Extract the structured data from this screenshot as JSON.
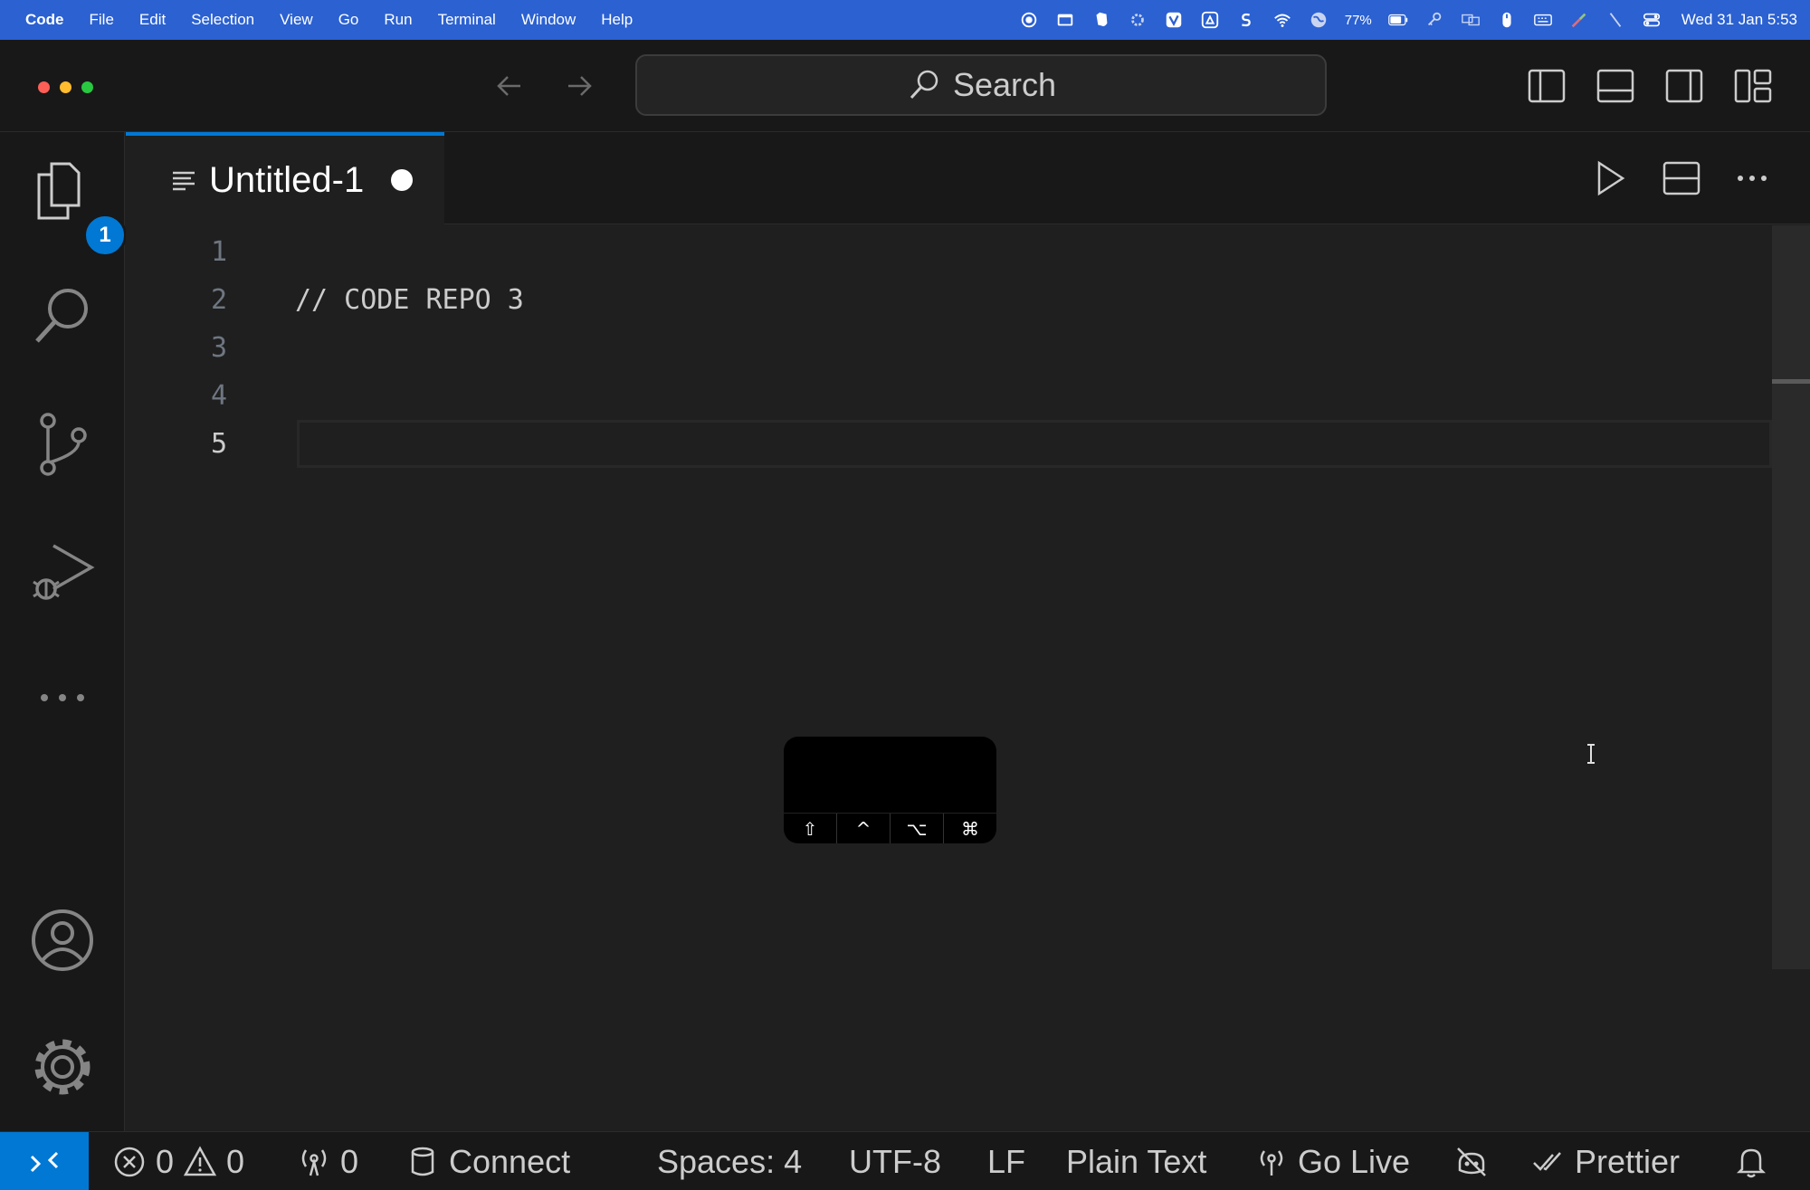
{
  "menubar": {
    "apple": "",
    "items": [
      "Code",
      "File",
      "Edit",
      "Selection",
      "View",
      "Go",
      "Run",
      "Terminal",
      "Window",
      "Help"
    ],
    "battery": "77%",
    "clock": "Wed 31 Jan 5:53"
  },
  "titlebar": {
    "search_label": "Search"
  },
  "activity": {
    "explorer_badge": "1"
  },
  "tab": {
    "label": "Untitled-1"
  },
  "editor": {
    "line_numbers": [
      "1",
      "2",
      "3",
      "4",
      "5"
    ],
    "lines": [
      "",
      "// CODE REPO 3",
      "",
      "",
      ""
    ],
    "key_overlay": [
      "⇧",
      "^",
      "⌥",
      "⌘"
    ]
  },
  "statusbar": {
    "errors": "0",
    "warnings": "0",
    "ports": "0",
    "connect": "Connect",
    "spaces": "Spaces: 4",
    "encoding": "UTF-8",
    "eol": "LF",
    "language": "Plain Text",
    "go_live": "Go Live",
    "prettier": "Prettier"
  },
  "colors": {
    "accent": "#0078d4",
    "menubar": "#2b61d1",
    "editor_bg": "#1f1f1f",
    "chrome_bg": "#181818"
  }
}
